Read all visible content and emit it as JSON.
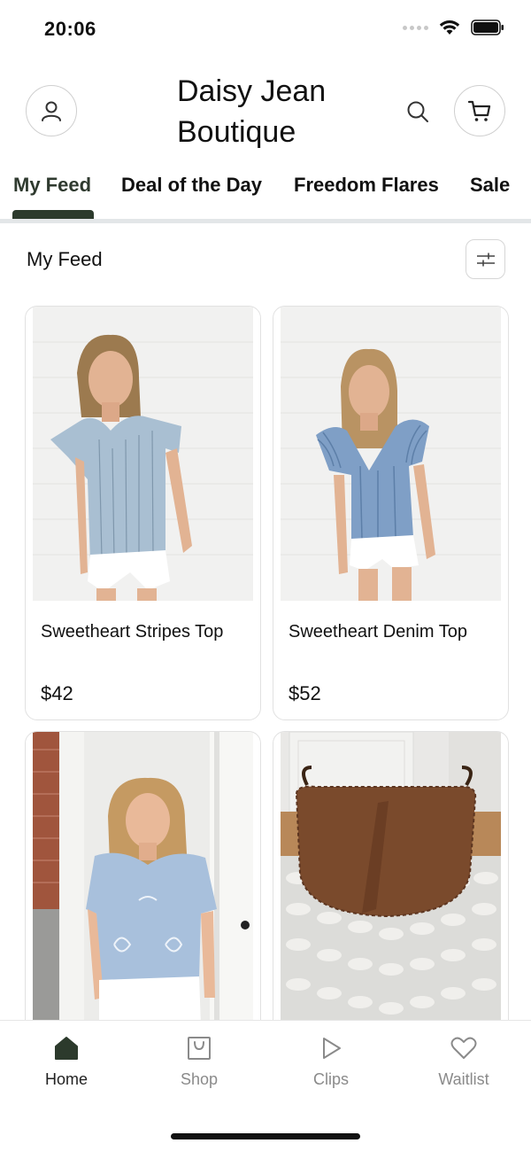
{
  "status": {
    "time": "20:06"
  },
  "header": {
    "store_name": "Daisy Jean Boutique"
  },
  "tabs": [
    {
      "label": "My Feed",
      "active": true
    },
    {
      "label": "Deal of the Day",
      "active": false
    },
    {
      "label": "Freedom Flares",
      "active": false
    },
    {
      "label": "Sale",
      "active": false
    }
  ],
  "feed": {
    "title": "My Feed"
  },
  "products": [
    {
      "name": "Sweetheart Stripes Top",
      "price": "$42",
      "image": "woman-in-striped-denim-top"
    },
    {
      "name": "Sweetheart Denim Top",
      "price": "$52",
      "image": "woman-in-ruffled-denim-top"
    },
    {
      "name": "",
      "price": "",
      "image": "woman-in-light-blue-embroidered-top"
    },
    {
      "name": "",
      "price": "",
      "image": "brown-leather-crossbody-bag"
    }
  ],
  "bottom_nav": [
    {
      "label": "Home",
      "icon": "home-icon",
      "active": true
    },
    {
      "label": "Shop",
      "icon": "shop-bag-icon",
      "active": false
    },
    {
      "label": "Clips",
      "icon": "play-icon",
      "active": false
    },
    {
      "label": "Waitlist",
      "icon": "heart-icon",
      "active": false
    }
  ],
  "colors": {
    "accent": "#2c3a2c",
    "muted": "#8a8a8a",
    "border": "#e1e1e1"
  }
}
